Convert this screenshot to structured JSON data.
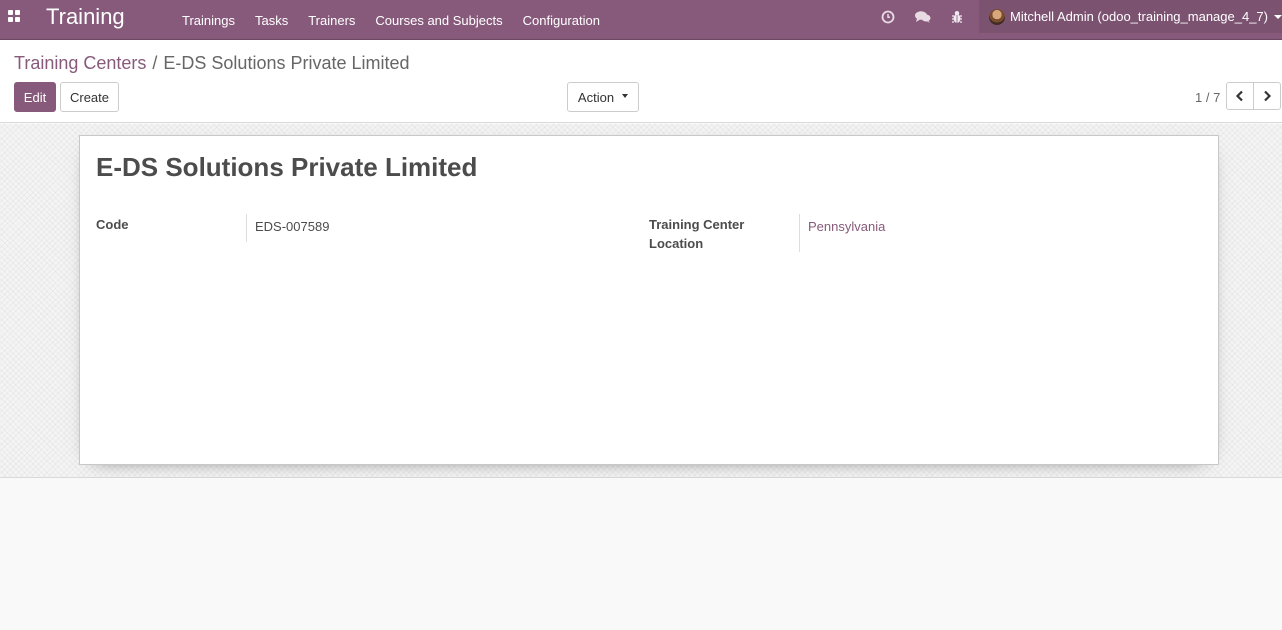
{
  "navbar": {
    "brand": "Training",
    "menu": [
      "Trainings",
      "Tasks",
      "Trainers",
      "Courses and Subjects",
      "Configuration"
    ],
    "user_name": "Mitchell Admin (odoo_training_manage_4_7)",
    "icons": [
      "apps-icon",
      "clock-icon",
      "chat-icon",
      "bug-icon"
    ],
    "accent_color": "#875a7b"
  },
  "breadcrumb": {
    "parent": "Training Centers",
    "separator": "/",
    "current": "E-DS Solutions Private Limited"
  },
  "toolbar": {
    "edit_label": "Edit",
    "create_label": "Create",
    "action_label": "Action"
  },
  "pager": {
    "value": "1 / 7"
  },
  "record": {
    "title": "E-DS Solutions Private Limited",
    "code_label": "Code",
    "code_value": "EDS-007589",
    "location_label_line1": "Training Center",
    "location_label_line2": "Location",
    "location_value": "Pennsylvania"
  }
}
